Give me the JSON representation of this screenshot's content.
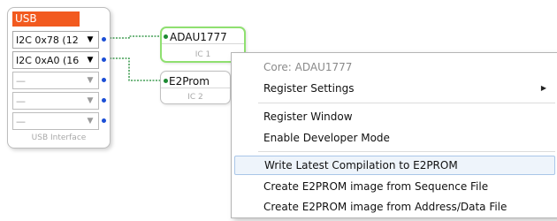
{
  "usb_interface": {
    "title": "USB",
    "rows": [
      {
        "label": "I2C 0x78 (12",
        "arrow": "▼",
        "active": true
      },
      {
        "label": "I2C 0xA0 (16",
        "arrow": "▼",
        "active": true
      },
      {
        "label": "—",
        "arrow": "▼",
        "active": false
      },
      {
        "label": "—",
        "arrow": "▼",
        "active": false
      },
      {
        "label": "—",
        "arrow": "▼",
        "active": false
      }
    ],
    "caption": "USB Interface"
  },
  "ic_blocks": [
    {
      "name": "ADAU1777",
      "sub": "IC 1",
      "selected": true
    },
    {
      "name": "E2Prom",
      "sub": "IC 2",
      "selected": false
    }
  ],
  "context_menu": {
    "header": "Core: ADAU1777",
    "items": [
      {
        "label": "Register Settings",
        "submenu_arrow": "▶"
      },
      {
        "label": "Register Window"
      },
      {
        "label": "Enable Developer Mode"
      },
      {
        "label": "Write Latest Compilation to E2PROM",
        "highlighted": true
      },
      {
        "label": "Create E2PROM image from Sequence File"
      },
      {
        "label": "Create E2PROM image from Address/Data File"
      }
    ]
  },
  "colors": {
    "usb_title": "#f25a1f",
    "selected_border": "#8fe070",
    "wire": "#1c8a32",
    "pin": "#1c4fd6",
    "menu_highlight": "#eef4fb"
  }
}
